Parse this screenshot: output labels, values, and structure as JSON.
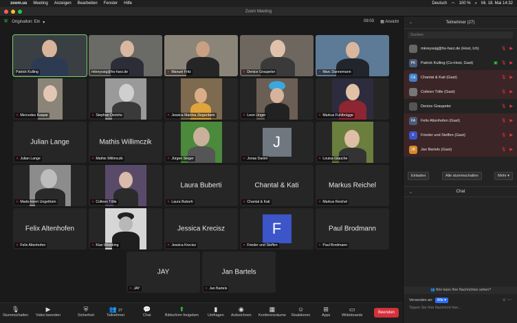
{
  "menubar": {
    "app": "zoom.us",
    "items": [
      "Meeting",
      "Anzeigen",
      "Bearbeiten",
      "Fenster",
      "Hilfe"
    ],
    "language": "Deutsch",
    "battery": "100 %",
    "datetime": "Mi. 18. Mai 14:32"
  },
  "window": {
    "title": "Zoom Meeting"
  },
  "topbar": {
    "original_sound": "Originalton: Ein",
    "timer": "09:03",
    "view_label": "Ansicht"
  },
  "tiles": [
    {
      "label": "Patrick Kulling",
      "active": true
    },
    {
      "label": "mkreyssig@hs-harz.de"
    },
    {
      "label": "Manuel Fritz"
    },
    {
      "label": "Denice Graupeter"
    },
    {
      "label": "Marc Dannemann"
    },
    {
      "label": "Mercedes Kaspar"
    },
    {
      "label": "Stephan Derichs"
    },
    {
      "label": "Jessica Martina Ziegenbein"
    },
    {
      "label": "Leon Unger"
    },
    {
      "label": "Markus Fuhlbrügge"
    },
    {
      "label": "Julian Lange",
      "center": "Julian Lange"
    },
    {
      "label": "Mathis Willimczik",
      "center": "Mathis Willimczik"
    },
    {
      "label": "Jürgen Singer"
    },
    {
      "label": "Jonas Daniel",
      "avatar": "J"
    },
    {
      "label": "Louisa Glauche"
    },
    {
      "label": "Mads-Henri Ungethüm"
    },
    {
      "label": "Colleen Tölle"
    },
    {
      "label": "Laura Buberti",
      "center": "Laura Buberti"
    },
    {
      "label": "Chantal & Kati",
      "center": "Chantal & Kati"
    },
    {
      "label": "Markus Reichel",
      "center": "Markus Reichel"
    },
    {
      "label": "Felix Altenhofen",
      "center": "Felix Altenhofen"
    },
    {
      "label": "Kian Wiebking"
    },
    {
      "label": "Jessica Krecisz",
      "center": "Jessica Krecisz"
    },
    {
      "label": "Frieder und Steffen",
      "avatar": "F"
    },
    {
      "label": "Paul Brodmann",
      "center": "Paul Brodmann"
    },
    {
      "label": "JAY",
      "center": "JAY"
    },
    {
      "label": "Jan Bartels",
      "center": "Jan Bartels"
    }
  ],
  "toolbar": {
    "mute": "Stummschalten",
    "video": "Video beenden",
    "security": "Sicherheit",
    "participants": "Teilnehmer",
    "participants_count": "27",
    "chat": "Chat",
    "share": "Bildschirm freigeben",
    "polls": "Umfragen",
    "record": "Aufzeichnen",
    "breakout": "Konferenzräume",
    "reactions": "Reaktionen",
    "apps": "Apps",
    "whiteboards": "Whiteboards",
    "end": "Beenden"
  },
  "panel": {
    "title": "Teilnehmer (27)",
    "search_placeholder": "Suchen",
    "participants": [
      {
        "name": "mkreyssig@hs-harz.de (Host, Ich)",
        "initials": "",
        "color": "#666666"
      },
      {
        "name": "Patrick Kulling (Co-Host, Gast)",
        "initials": "PK",
        "color": "#4a5a7a"
      },
      {
        "name": "Chantal & Kati (Gast)",
        "initials": "C&",
        "color": "#3f7fc9"
      },
      {
        "name": "Colleen Tölle (Gast)",
        "initials": "",
        "color": "#777777"
      },
      {
        "name": "Denice Graupeter",
        "initials": "",
        "color": "#555555"
      },
      {
        "name": "Felix Altenhofen (Gast)",
        "initials": "FA",
        "color": "#4a5a7a"
      },
      {
        "name": "Frieder und Steffen (Gast)",
        "initials": "F",
        "color": "#3c55c9"
      },
      {
        "name": "Jan Bartels (Gast)",
        "initials": "JB",
        "color": "#d98a2b"
      }
    ],
    "invite": "Einladen",
    "mute_all": "Alle stummschalten",
    "more": "Mehr",
    "chat_title": "Chat",
    "who_can": "Wer kann Ihre Nachrichten sehen?",
    "send_to": "Versenden an:",
    "send_to_value": "Alle",
    "input_placeholder": "Tippen Sie Ihre Nachricht hier..."
  }
}
